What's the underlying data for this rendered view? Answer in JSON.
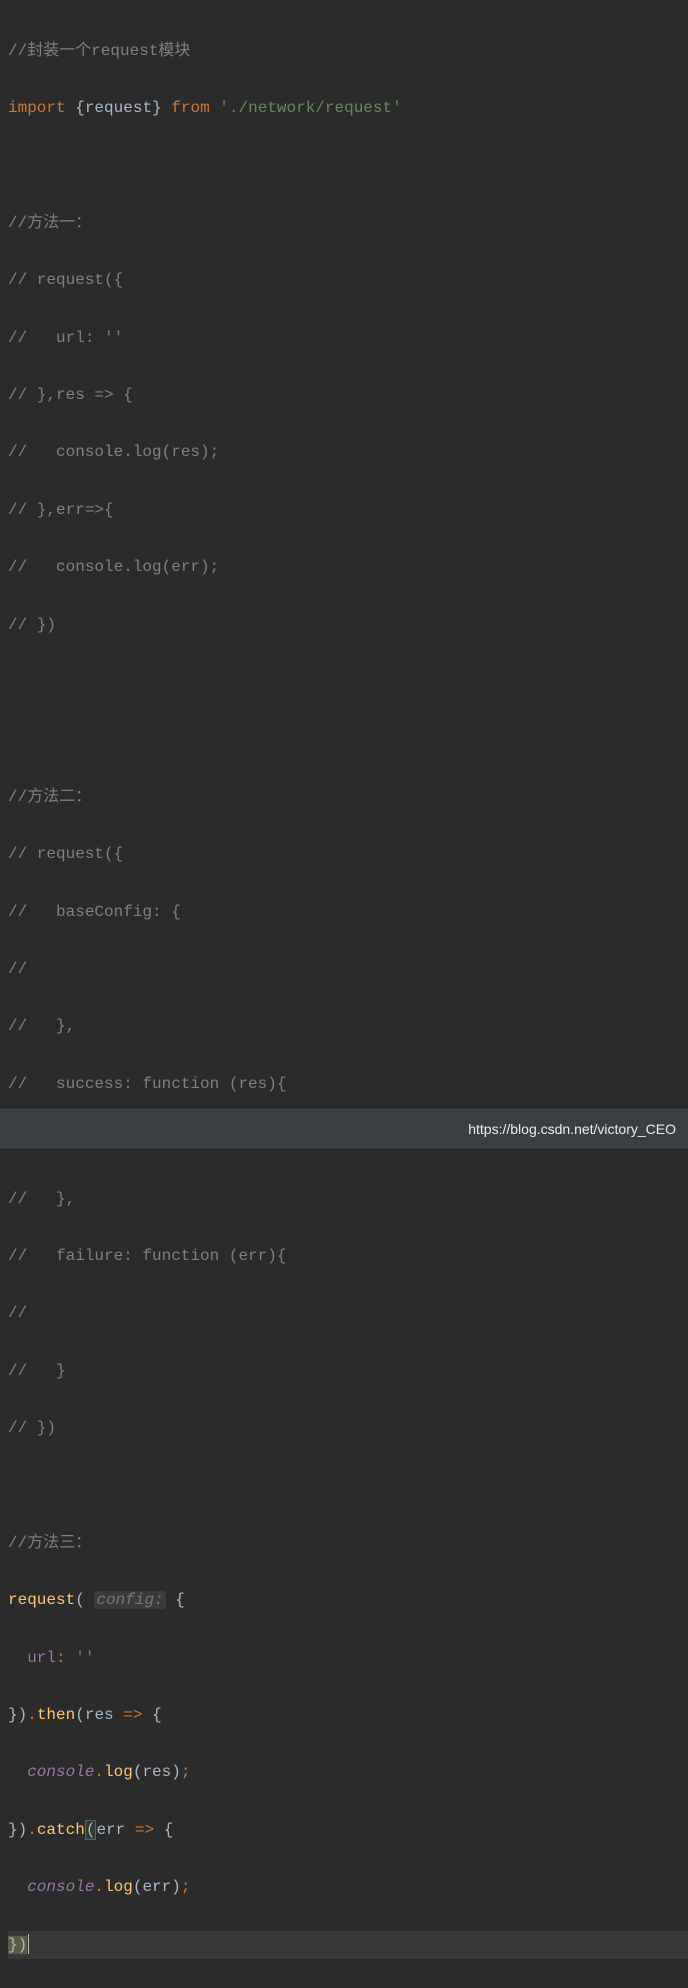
{
  "lines": {
    "l1": "//封装一个request模块",
    "l2_import": "import",
    "l2_braceL": "{",
    "l2_request": "request",
    "l2_braceR": "}",
    "l2_from": "from",
    "l2_string": "'./network/request'",
    "l3": "",
    "l4": "//方法一：",
    "l5": "// request({",
    "l6": "//   url: ''",
    "l7": "// },res => {",
    "l8": "//   console.log(res);",
    "l9": "// },err=>{",
    "l10": "//   console.log(err);",
    "l11": "// })",
    "l12": "",
    "l13": "",
    "l14": "//方法二：",
    "l15": "// request({",
    "l16": "//   baseConfig: {",
    "l17": "//",
    "l18": "//   },",
    "l19": "//   success: function (res){",
    "l20": "//",
    "l21": "//   },",
    "l22": "//   failure: function (err){",
    "l23": "//",
    "l24": "//   }",
    "l25": "// })",
    "l26": "",
    "l27": "//方法三：",
    "l28_request": "request",
    "l28_hint": "config:",
    "l28_brace": "{",
    "l29_url": "url",
    "l29_colon": ":",
    "l29_val": "''",
    "l30_close": "}).",
    "l30_then": "then",
    "l30_res": "res",
    "l30_arrow": "=>",
    "l30_brace": "{",
    "l31_console": "console",
    "l31_log": "log",
    "l31_res": "res",
    "l32_close": "}).",
    "l32_catch": "catch",
    "l32_err": "err",
    "l32_arrow": "=>",
    "l32_brace": "{",
    "l33_console": "console",
    "l33_log": "log",
    "l33_err": "err",
    "l34_close": "})"
  },
  "watermark": "https://blog.csdn.net/victory_CEO"
}
